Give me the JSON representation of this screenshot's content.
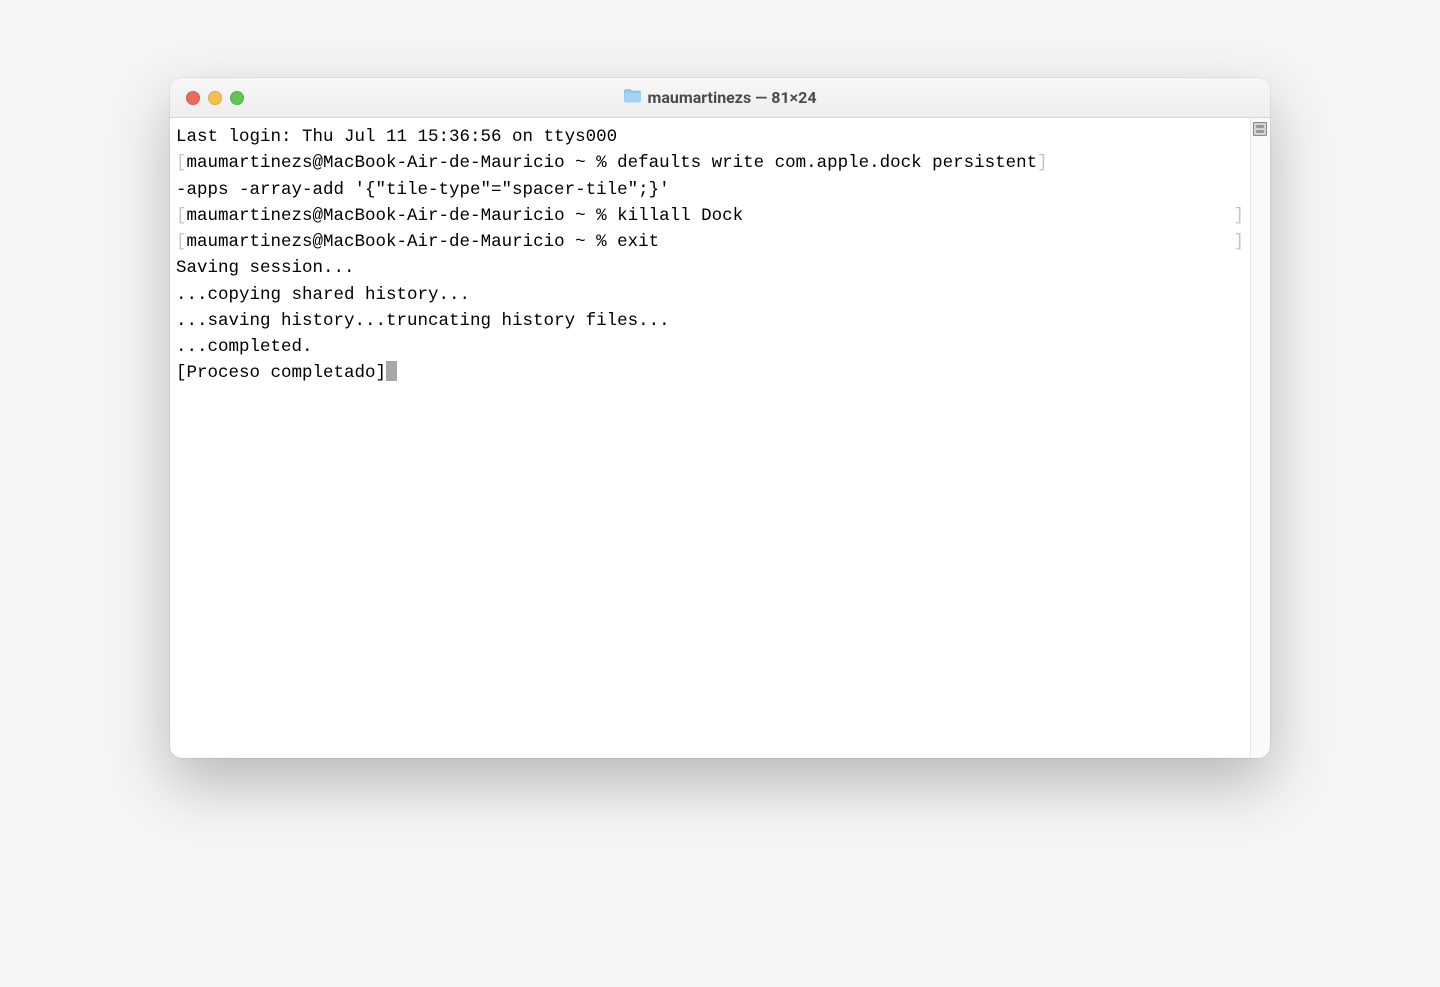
{
  "window": {
    "title": "maumartinezs — 81×24"
  },
  "terminal": {
    "lines": {
      "last_login": "Last login: Thu Jul 11 15:36:56 on ttys000",
      "prompt1": "maumartinezs@MacBook-Air-de-Mauricio ~ % defaults write com.apple.dock persistent",
      "prompt1_cont": "-apps -array-add '{\"tile-type\"=\"spacer-tile\";}'",
      "prompt2": "maumartinezs@MacBook-Air-de-Mauricio ~ % killall Dock",
      "prompt3": "maumartinezs@MacBook-Air-de-Mauricio ~ % exit",
      "blank1": "",
      "saving": "Saving session...",
      "copying": "...copying shared history...",
      "saving_hist": "...saving history...truncating history files...",
      "completed": "...completed.",
      "blank2": "",
      "proceso": "[Proceso completado]"
    }
  }
}
